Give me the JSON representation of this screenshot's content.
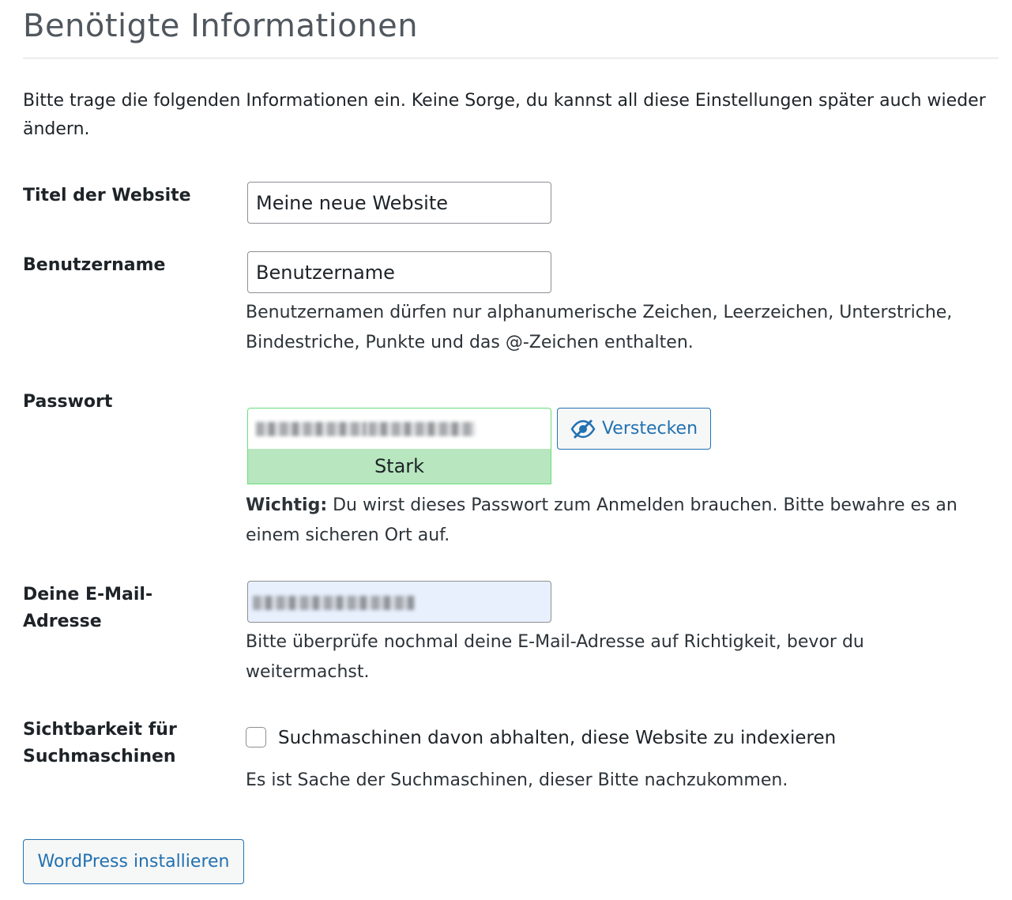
{
  "page": {
    "title": "Benötigte Informationen",
    "intro": "Bitte trage die folgenden Informationen ein. Keine Sorge, du kannst all diese Einstellungen später auch wieder ändern."
  },
  "site_title": {
    "label": "Titel der Website",
    "value": "Meine neue Website"
  },
  "username": {
    "label": "Benutzername",
    "value": "Benutzername",
    "description": "Benutzernamen dürfen nur alphanumerische Zeichen, Leerzeichen, Unterstriche, Bindestriche, Punkte und das @-Zeichen enthalten."
  },
  "password": {
    "label": "Passwort",
    "strength": "Stark",
    "hide_button": "Verstecken",
    "hide_icon": "eye-slash-icon",
    "important_label": "Wichtig:",
    "important_text": " Du wirst dieses Passwort zum Anmelden brauchen. Bitte bewahre es an einem sicheren Ort auf."
  },
  "email": {
    "label": "Deine E-Mail-Adresse",
    "description": "Bitte überprüfe nochmal deine E-Mail-Adresse auf Richtigkeit, bevor du weitermachst."
  },
  "search_visibility": {
    "label": "Sichtbarkeit für Suchmaschinen",
    "checkbox_label": "Suchmaschinen davon abhalten, diese Website zu indexieren",
    "checked": false,
    "description": "Es ist Sache der Suchmaschinen, dieser Bitte nachzukommen."
  },
  "submit": {
    "label": "WordPress installieren"
  },
  "colors": {
    "accent": "#2271b1",
    "strength_bg": "#b8e6bf",
    "strength_border": "#68de7c",
    "autofill_bg": "#e8f0fe"
  }
}
